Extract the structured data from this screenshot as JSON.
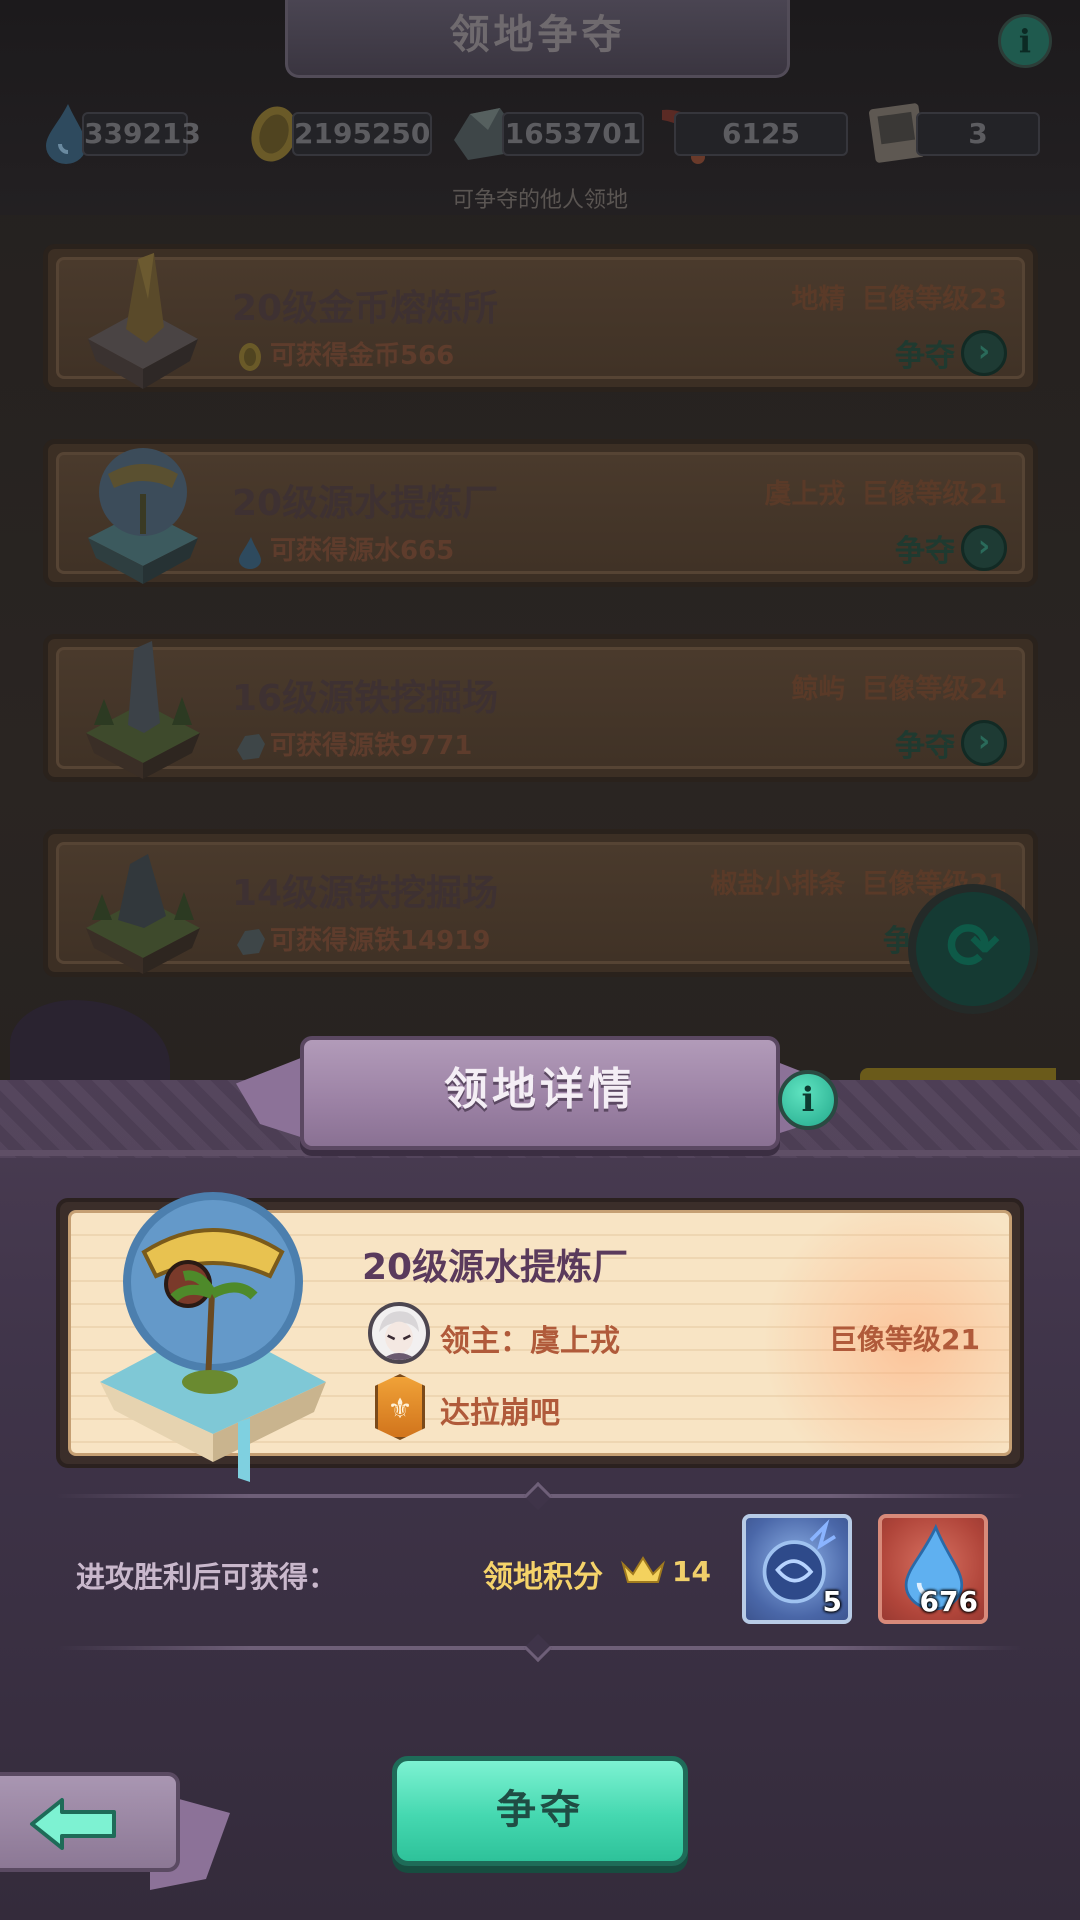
{
  "screen": {
    "title": "领地争夺",
    "info_icon": "info-icon",
    "subtitle": "可争夺的他人领地"
  },
  "resources": [
    {
      "icon": "water-drop-icon",
      "value": "339213"
    },
    {
      "icon": "gold-coin-icon",
      "value": "2195250"
    },
    {
      "icon": "iron-ore-icon",
      "value": "1653701"
    },
    {
      "icon": "horn-icon",
      "value": "6125"
    },
    {
      "icon": "challenge-ticket-icon",
      "value": "3"
    }
  ],
  "territories": [
    {
      "title": "20级金币熔炼所",
      "reward_icon": "gold-coin-icon",
      "reward": "可获得金币566",
      "owner": "地精",
      "colossus": "巨像等级23",
      "action": "争夺"
    },
    {
      "title": "20级源水提炼厂",
      "reward_icon": "water-drop-icon",
      "reward": "可获得源水665",
      "owner": "虞上戎",
      "colossus": "巨像等级21",
      "action": "争夺"
    },
    {
      "title": "16级源铁挖掘场",
      "reward_icon": "iron-ore-icon",
      "reward": "可获得源铁9771",
      "owner": "鲸屿",
      "colossus": "巨像等级24",
      "action": "争夺"
    },
    {
      "title": "14级源铁挖掘场",
      "reward_icon": "iron-ore-icon",
      "reward": "可获得源铁14919",
      "owner": "椒盐小排条",
      "colossus": "巨像等级21",
      "action": "争"
    }
  ],
  "detail": {
    "header": "领地详情",
    "title": "20级源水提炼厂",
    "lord": "领主：虞上戎",
    "colossus": "巨像等级21",
    "guild": "达拉崩吧",
    "reward_label": "进攻胜利后可获得：",
    "score_label": "领地积分",
    "score_value": "14",
    "items": [
      {
        "icon": "blue-orb-icon",
        "count": "5"
      },
      {
        "icon": "water-drop-icon",
        "count": "676"
      }
    ],
    "claim_button": "争夺"
  },
  "colors": {
    "accent_teal": "#45d8b0",
    "panel_purple": "#3f3449",
    "gold_text": "#f5d36a",
    "card_cream": "#f8e4c4"
  }
}
